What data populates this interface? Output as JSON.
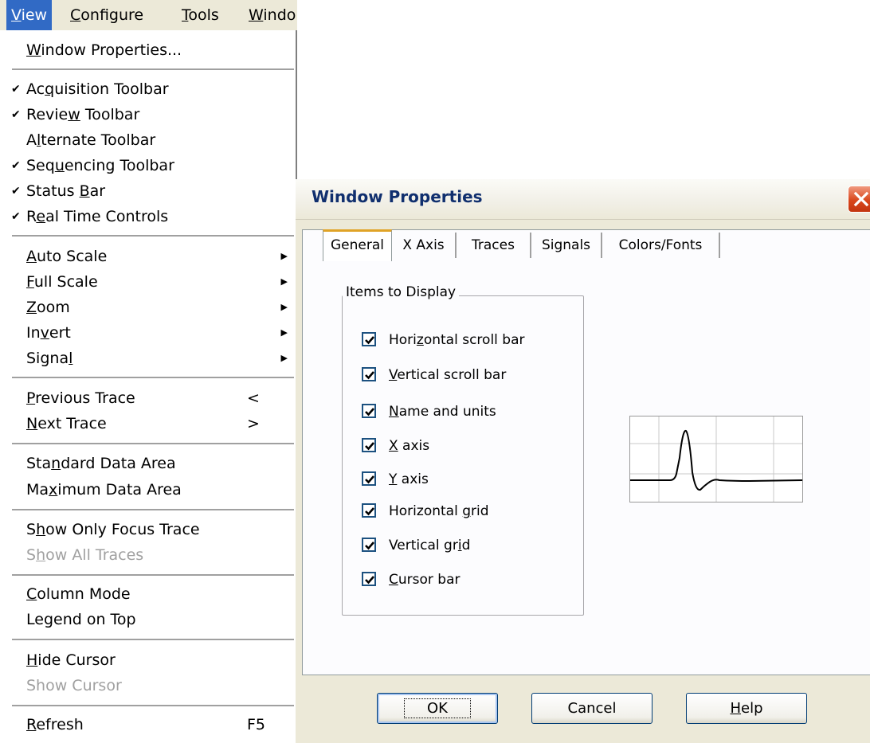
{
  "menubar": {
    "items": [
      {
        "label": "View",
        "mn": "V",
        "rest": "iew",
        "active": true
      },
      {
        "label": "Configure",
        "mn": "C",
        "rest": "onfigure"
      },
      {
        "label": "Tools",
        "mn": "T",
        "rest": "ools"
      },
      {
        "label": "Windo",
        "mn": "W",
        "rest": "indo"
      }
    ]
  },
  "view_menu": {
    "window_properties": {
      "pre": "",
      "mn": "W",
      "post": "indow Properties..."
    },
    "acquisition_toolbar": {
      "pre": "Ac",
      "mn": "q",
      "post": "uisition Toolbar",
      "checked": true
    },
    "review_toolbar": {
      "pre": "Revie",
      "mn": "w",
      "post": " Toolbar",
      "checked": true
    },
    "alternate_toolbar": {
      "pre": "A",
      "mn": "l",
      "post": "ternate Toolbar",
      "checked": false
    },
    "sequencing_toolbar": {
      "pre": "Seq",
      "mn": "u",
      "post": "encing Toolbar",
      "checked": true
    },
    "status_bar": {
      "pre": "Status ",
      "mn": "B",
      "post": "ar",
      "checked": true
    },
    "real_time_controls": {
      "pre": "R",
      "mn": "e",
      "post": "al Time Controls",
      "checked": true
    },
    "auto_scale": {
      "pre": "",
      "mn": "A",
      "post": "uto Scale"
    },
    "full_scale": {
      "pre": "",
      "mn": "F",
      "post": "ull Scale"
    },
    "zoom": {
      "pre": "",
      "mn": "Z",
      "post": "oom"
    },
    "invert": {
      "pre": "In",
      "mn": "v",
      "post": "ert"
    },
    "signal": {
      "pre": "Signa",
      "mn": "l",
      "post": ""
    },
    "previous_trace": {
      "pre": "",
      "mn": "P",
      "post": "revious Trace",
      "shortcut": "<"
    },
    "next_trace": {
      "pre": "",
      "mn": "N",
      "post": "ext Trace",
      "shortcut": ">"
    },
    "standard_data_area": {
      "pre": "Sta",
      "mn": "n",
      "post": "dard Data Area"
    },
    "maximum_data_area": {
      "pre": "Ma",
      "mn": "x",
      "post": "imum Data Area"
    },
    "show_only_focus_trace": {
      "pre": "S",
      "mn": "h",
      "post": "ow Only Focus Trace"
    },
    "show_all_traces": {
      "pre": "S",
      "mn": "h",
      "post": "ow All Traces"
    },
    "column_mode": {
      "pre": "",
      "mn": "C",
      "post": "olumn Mode"
    },
    "legend_on_top": {
      "pre": "Legend on Top",
      "mn": "",
      "post": ""
    },
    "hide_cursor": {
      "pre": "",
      "mn": "H",
      "post": "ide Cursor"
    },
    "show_cursor": {
      "pre": "Show Cursor",
      "mn": "",
      "post": ""
    },
    "refresh": {
      "pre": "",
      "mn": "R",
      "post": "efresh",
      "shortcut": "F5"
    }
  },
  "dialog": {
    "title": "Window Properties",
    "tabs": [
      "General",
      "X Axis",
      "Traces",
      "Signals",
      "Colors/Fonts"
    ],
    "group_title": "Items to Display",
    "checkboxes": [
      {
        "pre": "Hori",
        "mn": "z",
        "post": "ontal scroll bar",
        "checked": true
      },
      {
        "pre": "",
        "mn": "V",
        "post": "ertical scroll bar",
        "checked": true
      },
      {
        "pre": "",
        "mn": "N",
        "post": "ame and units",
        "checked": true
      },
      {
        "pre": "",
        "mn": "X",
        "post": " axis",
        "checked": true
      },
      {
        "pre": "",
        "mn": "Y",
        "post": " axis",
        "checked": true
      },
      {
        "pre": "Horizontal ",
        "mn": "g",
        "post": "rid",
        "checked": true
      },
      {
        "pre": "Vertical gr",
        "mn": "i",
        "post": "d",
        "checked": true
      },
      {
        "pre": "",
        "mn": "C",
        "post": "ursor bar",
        "checked": true
      }
    ],
    "buttons": {
      "ok": "OK",
      "cancel": "Cancel",
      "help": {
        "pre": "",
        "mn": "H",
        "post": "elp"
      }
    }
  },
  "colors": {
    "menu_highlight": "#316ac5",
    "dialog_face": "#ece9d8",
    "title_text": "#102f6e",
    "close_button": "#d9471c",
    "tab_accent": "#e0a326"
  }
}
